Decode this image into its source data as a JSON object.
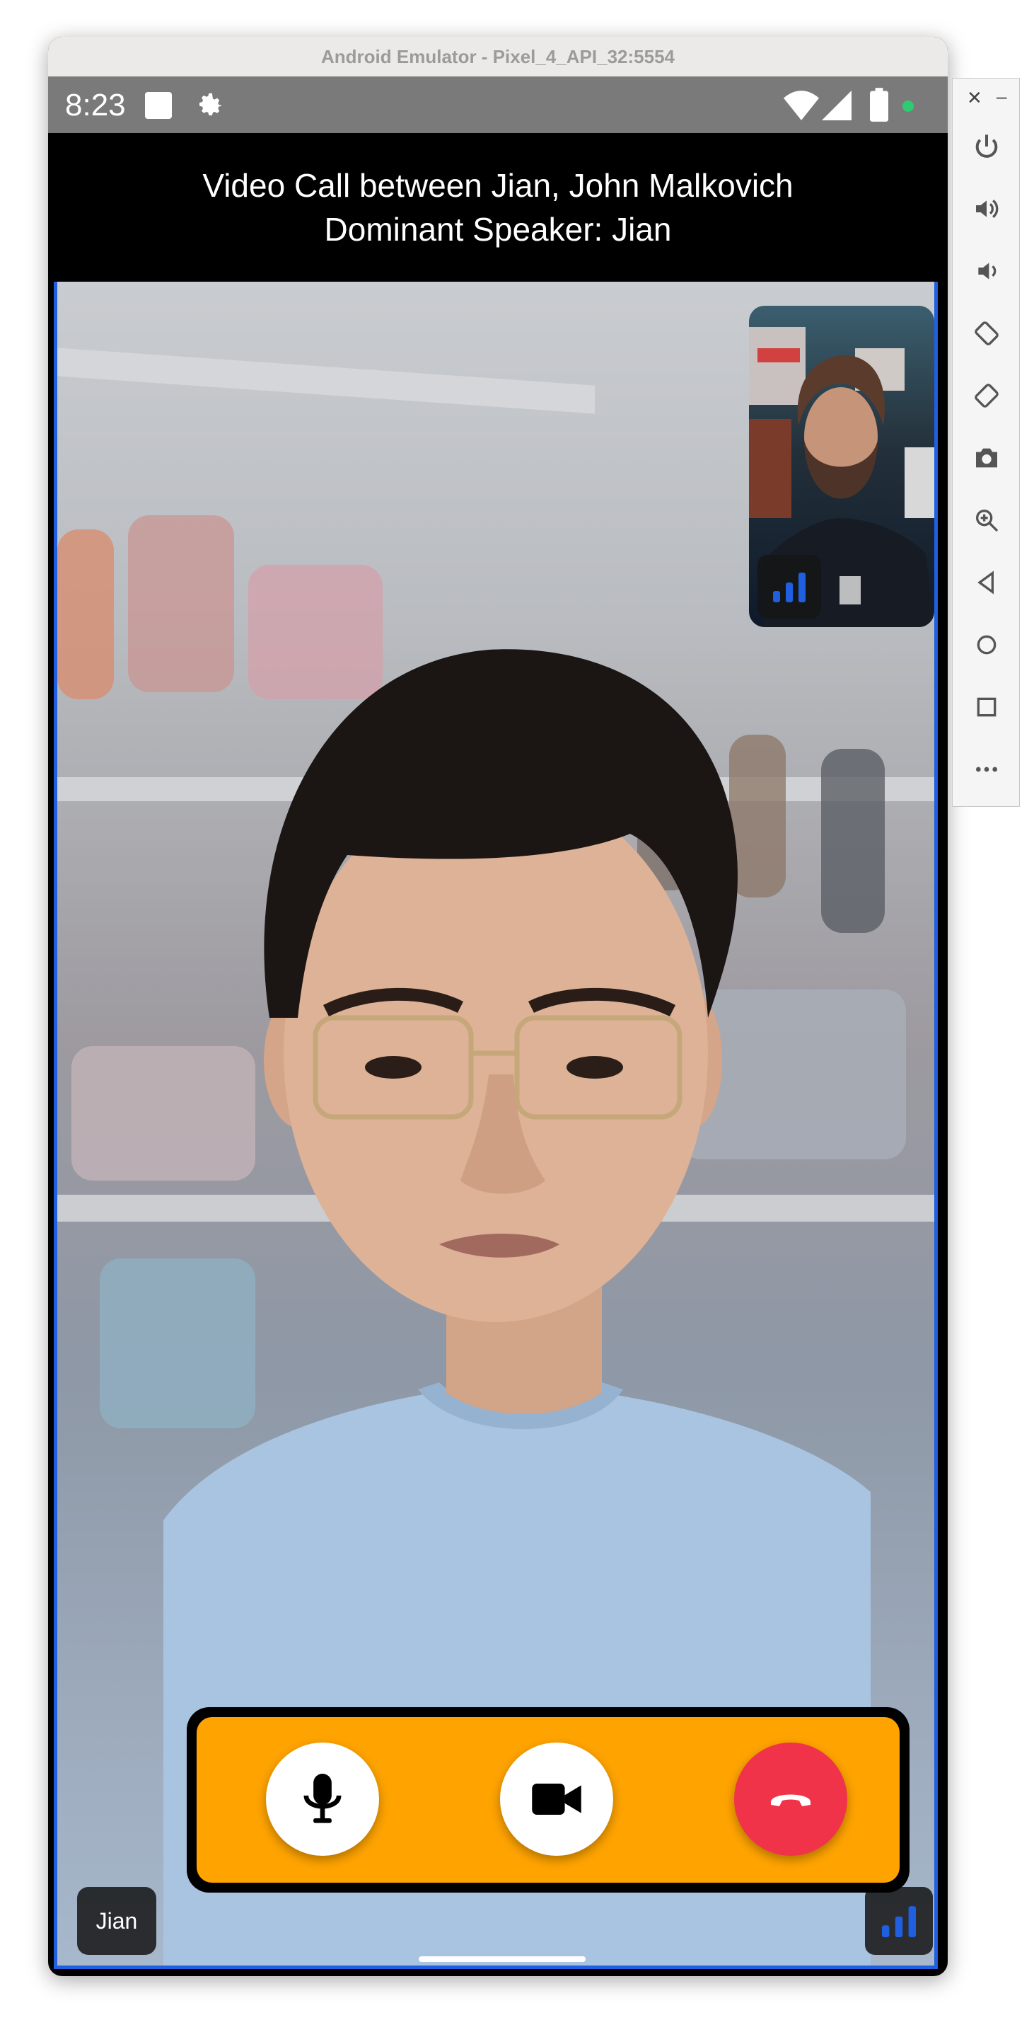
{
  "window": {
    "title": "Android Emulator - Pixel_4_API_32:5554"
  },
  "status_bar": {
    "time": "8:23"
  },
  "call": {
    "title_line1": "Video Call between Jian, John Malkovich",
    "title_line2": "Dominant Speaker: Jian",
    "local_participant_name": "Jian"
  },
  "colors": {
    "control_bar": "#fea300",
    "end_call": "#f1334a",
    "signal": "#1f5fe0",
    "active_speaker_border": "#1f5fe0"
  },
  "toolbar": {
    "items": [
      "power-icon",
      "volume-up-icon",
      "volume-down-icon",
      "rotate-left-icon",
      "rotate-right-icon",
      "camera-icon",
      "zoom-icon",
      "back-icon",
      "home-icon",
      "overview-icon",
      "more-icon"
    ]
  }
}
